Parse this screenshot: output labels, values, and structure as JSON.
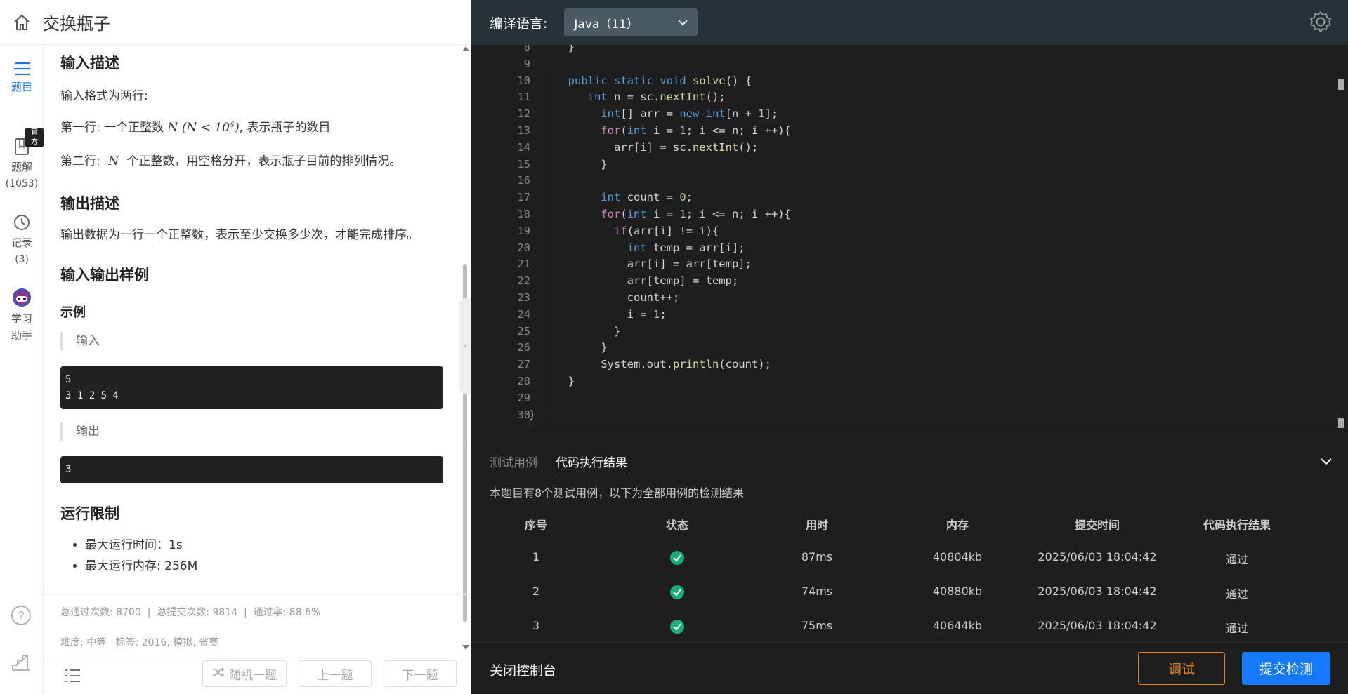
{
  "header": {
    "title": "交换瓶子"
  },
  "rail": {
    "items": [
      {
        "label": "题目"
      },
      {
        "label": "题解",
        "count": "(1053)",
        "badge": "官方"
      },
      {
        "label": "记录",
        "count": "(3)"
      },
      {
        "label": "学习",
        "label2": "助手"
      }
    ]
  },
  "problem": {
    "input_title": "输入描述",
    "input_line1": "输入格式为两行:",
    "input_line2_pre": "第一行: 一个正整数",
    "input_line2_post": ", 表示瓶子的数目",
    "input_line3_pre": "第二行:",
    "input_line3_post": "个正整数，用空格分开，表示瓶子目前的排列情况。",
    "math_n": "N",
    "math_constraint_base": "(N < 10",
    "math_constraint_exp": "4",
    "math_constraint_close": ")",
    "output_title": "输出描述",
    "output_line": "输出数据为一行一个正整数，表示至少交换多少次，才能完成排序。",
    "samples_title": "输入输出样例",
    "example_title": "示例",
    "input_label": "输入",
    "input_sample_line1": "5",
    "input_sample_line2": "3 1 2 5 4",
    "output_label": "输出",
    "output_sample": "3",
    "limits_title": "运行限制",
    "limit_time": "最大运行时间：1s",
    "limit_mem": "最大运行内存: 256M"
  },
  "stats": {
    "text": "总通过次数: 8700  |  总提交次数: 9814  |  通过率: 88.6%",
    "tags": "难度: 中等   标签: 2016, 模拟, 省赛"
  },
  "bottom_nav": {
    "random": "随机一题",
    "prev": "上一题",
    "next": "下一题"
  },
  "editor": {
    "lang_label": "编译语言:",
    "lang_value": "Java（11）",
    "lines": [
      {
        "n": "8"
      },
      {
        "n": "9"
      },
      {
        "n": "10"
      },
      {
        "n": "11"
      },
      {
        "n": "12"
      },
      {
        "n": "13"
      },
      {
        "n": "14"
      },
      {
        "n": "15"
      },
      {
        "n": "16"
      },
      {
        "n": "17"
      },
      {
        "n": "18"
      },
      {
        "n": "19"
      },
      {
        "n": "20"
      },
      {
        "n": "21"
      },
      {
        "n": "22"
      },
      {
        "n": "23"
      },
      {
        "n": "24"
      },
      {
        "n": "25"
      },
      {
        "n": "26"
      },
      {
        "n": "27"
      },
      {
        "n": "28"
      },
      {
        "n": "29"
      },
      {
        "n": "30"
      }
    ]
  },
  "console": {
    "tab_testcases": "测试用例",
    "tab_results": "代码执行结果",
    "summary": "本题目有8个测试用例，以下为全部用例的检测结果",
    "headers": [
      "序号",
      "状态",
      "用时",
      "内存",
      "提交时间",
      "代码执行结果"
    ],
    "rows": [
      {
        "id": "1",
        "time": "87ms",
        "mem": "40804kb",
        "submitted": "2025/06/03 18:04:42",
        "result": "通过"
      },
      {
        "id": "2",
        "time": "74ms",
        "mem": "40880kb",
        "submitted": "2025/06/03 18:04:42",
        "result": "通过"
      },
      {
        "id": "3",
        "time": "75ms",
        "mem": "40644kb",
        "submitted": "2025/06/03 18:04:42",
        "result": "通过"
      }
    ],
    "status_color": "#1aad7a"
  },
  "footer": {
    "close": "关闭控制台",
    "debug": "调试",
    "submit": "提交检测"
  }
}
